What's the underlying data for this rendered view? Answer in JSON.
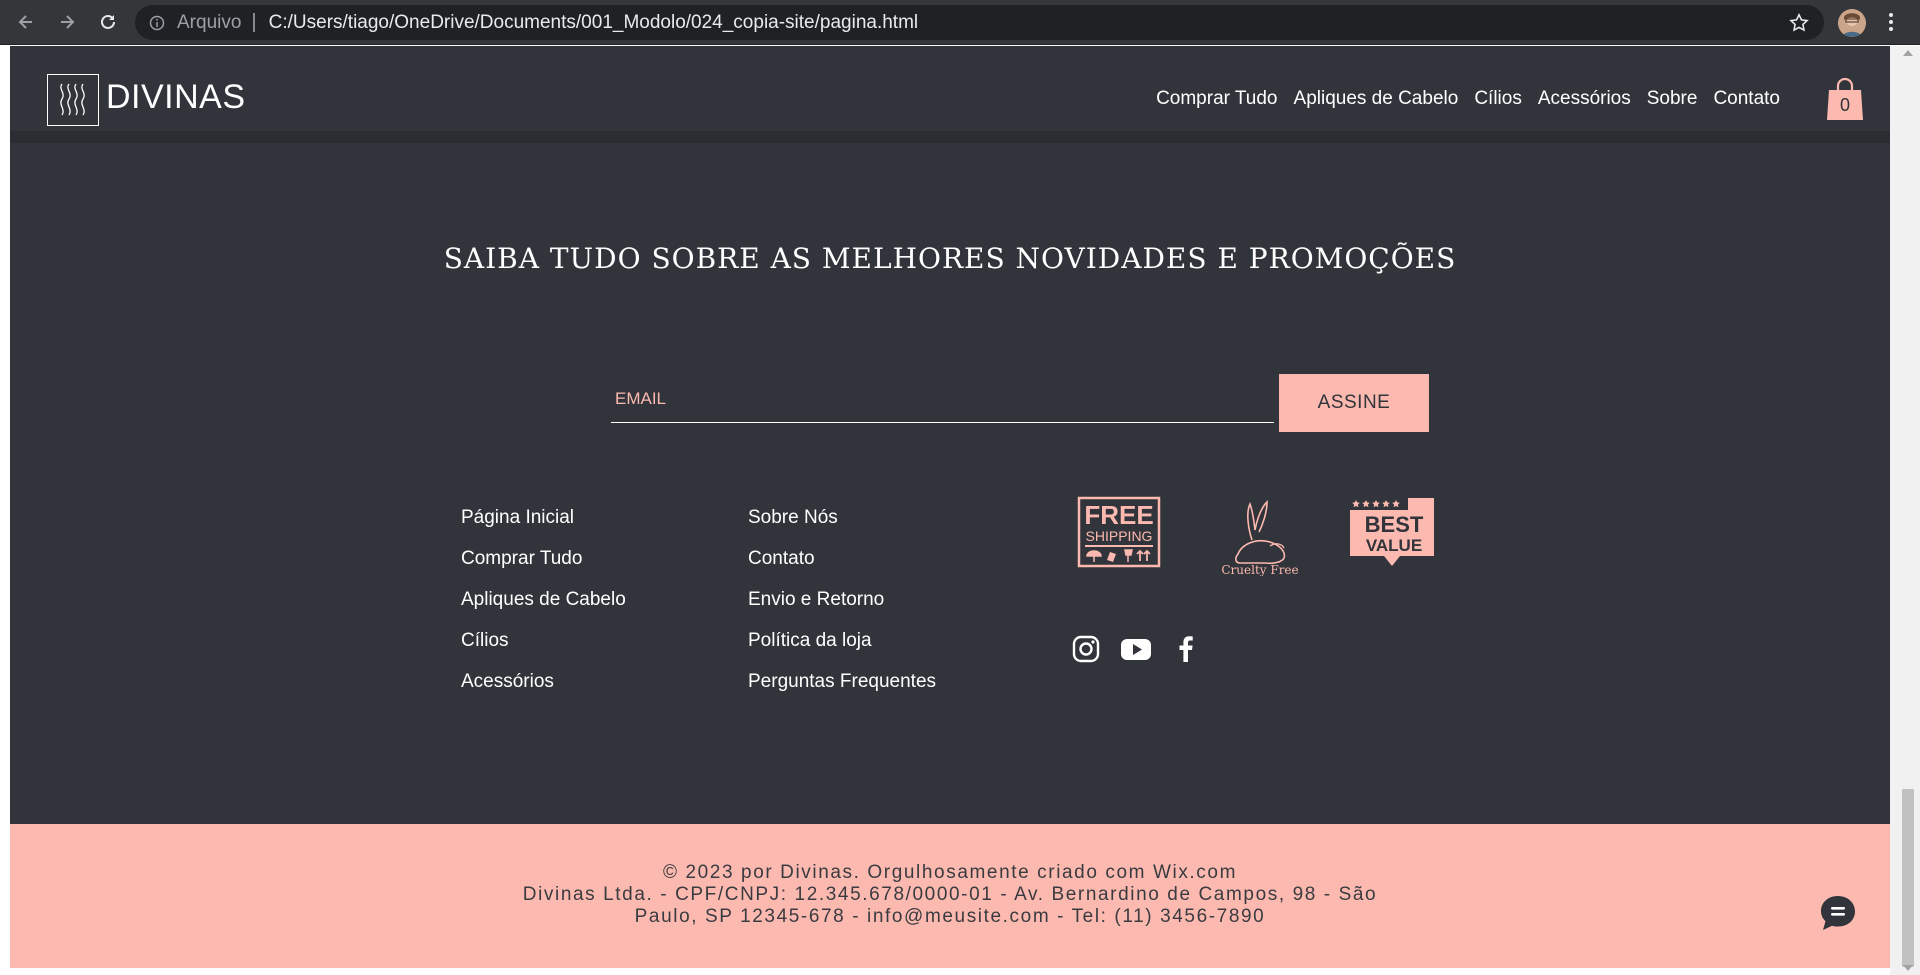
{
  "browser": {
    "scheme_label": "Arquivo",
    "url": "C:/Users/tiago/OneDrive/Documents/001_Modolo/024_copia-site/pagina.html"
  },
  "header": {
    "logo_text": "DIVINAS",
    "nav": [
      "Comprar Tudo",
      "Apliques de Cabelo",
      "Cílios",
      "Acessórios",
      "Sobre",
      "Contato"
    ],
    "cart_count": "0"
  },
  "newsletter": {
    "headline": "SAIBA TUDO SOBRE AS MELHORES NOVIDADES E PROMOÇÕES",
    "email_placeholder": "EMAIL",
    "button_label": "ASSINE"
  },
  "footer": {
    "col1": [
      "Página Inicial",
      "Comprar Tudo",
      "Apliques de Cabelo",
      "Cílios",
      "Acessórios"
    ],
    "col2": [
      "Sobre Nós",
      "Contato",
      "Envio e Retorno",
      "Política da loja",
      "Perguntas Frequentes"
    ],
    "badges": {
      "free_line1": "FREE",
      "free_line2": "SHIPPING",
      "cruelty": "Cruelty Free",
      "best_line1": "BEST",
      "best_line2": "VALUE"
    },
    "social_icons": [
      "instagram-icon",
      "youtube-icon",
      "facebook-icon"
    ]
  },
  "bottom": {
    "line1": "© 2023 por Divinas. Orgulhosamente criado com Wix.com",
    "line2": "Divinas Ltda. - CPF/CNPJ: 12.345.678/0000-01 - Av. Bernardino de Campos, 98 - São",
    "line3": "Paulo, SP 12345-678 - info@meusite.com - Tel: (11) 3456-7890"
  },
  "colors": {
    "dark_bg": "#31343a",
    "accent_pink": "#fcb9af",
    "chrome_bg": "#35363a"
  }
}
